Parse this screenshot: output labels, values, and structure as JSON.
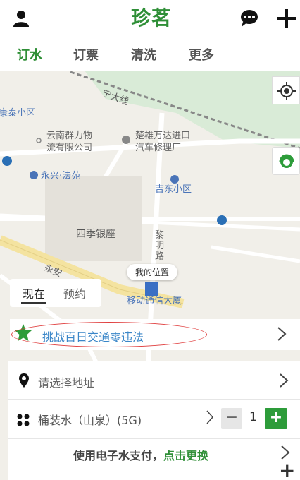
{
  "header": {
    "logo_text": "珍茗",
    "icons": [
      "user-icon",
      "chat-icon",
      "plus-icon"
    ]
  },
  "tabs": [
    {
      "label": "订水",
      "active": true
    },
    {
      "label": "订票",
      "active": false
    },
    {
      "label": "清洗",
      "active": false
    },
    {
      "label": "更多",
      "active": false
    }
  ],
  "map": {
    "labels": {
      "railway": "宁大线",
      "kangtai": "康泰小区",
      "yunnan": "云南群力物\n流有限公司",
      "chuxiong": "楚雄万达进口\n汽车修理厂",
      "yongxing": "永兴·法苑",
      "jidong": "吉东小区",
      "siji": "四季银座",
      "liming": "黎\n明\n路",
      "yongan": "永安",
      "mobile": "移动通信大厦"
    },
    "my_location": "我的位置"
  },
  "mode_switch": {
    "now": "现在",
    "reserve": "预约"
  },
  "banner": {
    "text": "挑战百日交通零违法"
  },
  "order": {
    "address_placeholder": "请选择地址",
    "product": "桶装水（山泉）(5G)",
    "quantity": "1",
    "pay_prefix": "使用电子水支付，",
    "pay_link": "点击更换"
  },
  "colors": {
    "brand_green": "#2f8f37",
    "banner_blue": "#3a86c8",
    "plus_green": "#2d9c3a"
  }
}
